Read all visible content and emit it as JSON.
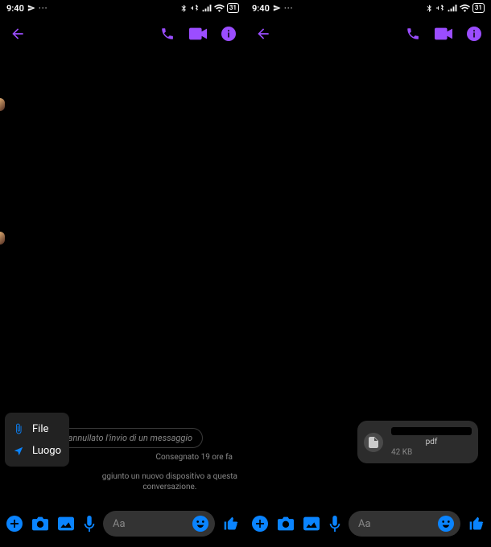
{
  "status": {
    "time": "9:40",
    "battery": "31"
  },
  "accent_color": "#0a84ff",
  "header_color": "#9b4dff",
  "left": {
    "unsent_text": "Hai annullato l'invio di un messaggio",
    "delivered_text": "Consegnato 19 ore fa",
    "system_text_l1": "ggiunto un nuovo dispositivo a questa",
    "system_text_l2": "conversazione.",
    "menu_file": "File",
    "menu_place": "Luogo"
  },
  "right": {
    "file_ext": "pdf",
    "file_size": "42 KB"
  },
  "input": {
    "placeholder": "Aa"
  }
}
